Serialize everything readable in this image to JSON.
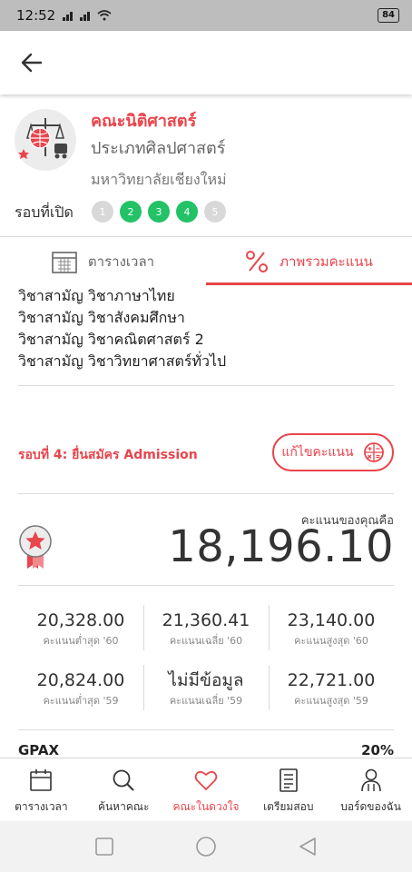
{
  "status_bar": {
    "time": "12:52",
    "battery": "84"
  },
  "faculty": {
    "name": "คณะนิติศาสตร์",
    "type": "ประเภทศิลปศาสตร์",
    "university": "มหาวิทยาลัยเชียงใหม่",
    "rounds_label": "รอบที่เปิด",
    "rounds": [
      {
        "label": "1",
        "open": false
      },
      {
        "label": "2",
        "open": true
      },
      {
        "label": "3",
        "open": true
      },
      {
        "label": "4",
        "open": true
      },
      {
        "label": "5",
        "open": false
      }
    ]
  },
  "tabs": [
    {
      "label": "ตารางเวลา",
      "icon": "calendar-icon",
      "active": false
    },
    {
      "label": "ภาพรวมคะแนน",
      "icon": "percent-icon",
      "active": true
    }
  ],
  "subjects": [
    "วิชาสามัญ วิชาภาษาไทย",
    "วิชาสามัญ วิชาสังคมศึกษา",
    "วิชาสามัญ วิชาคณิตศาสตร์ 2",
    "วิชาสามัญ วิชาวิทยาศาสตร์ทั่วไป"
  ],
  "round_info": {
    "title": "รอบที่ 4: ยื่นสมัคร Admission",
    "edit_label": "แก้ไขคะแนน"
  },
  "score": {
    "caption": "คะแนนของคุณคือ",
    "value": "18,196.10"
  },
  "stats": [
    [
      {
        "value": "20,328.00",
        "label": "คะแนนต่ำสุด '60"
      },
      {
        "value": "21,360.41",
        "label": "คะแนนเฉลี่ย '60"
      },
      {
        "value": "23,140.00",
        "label": "คะแนนสูงสุด '60"
      }
    ],
    [
      {
        "value": "20,824.00",
        "label": "คะแนนต่ำสุด '59"
      },
      {
        "value": "ไม่มีข้อมูล",
        "label": "คะแนนเฉลี่ย '59"
      },
      {
        "value": "22,721.00",
        "label": "คะแนนสูงสุด '59"
      }
    ]
  ],
  "gpax": {
    "label": "GPAX",
    "value": "20%"
  },
  "bottom_nav": [
    {
      "label": "ตารางเวลา",
      "icon": "calendar-icon",
      "active": false
    },
    {
      "label": "ค้นหาคณะ",
      "icon": "search-icon",
      "active": false
    },
    {
      "label": "คณะในดวงใจ",
      "icon": "heart-icon",
      "active": true
    },
    {
      "label": "เตรียมสอบ",
      "icon": "checklist-icon",
      "active": false
    },
    {
      "label": "บอร์ดของฉัน",
      "icon": "user-icon",
      "active": false
    }
  ],
  "colors": {
    "accent": "#e8454c",
    "round_open": "#23c266",
    "round_closed": "#d8d8d8"
  }
}
